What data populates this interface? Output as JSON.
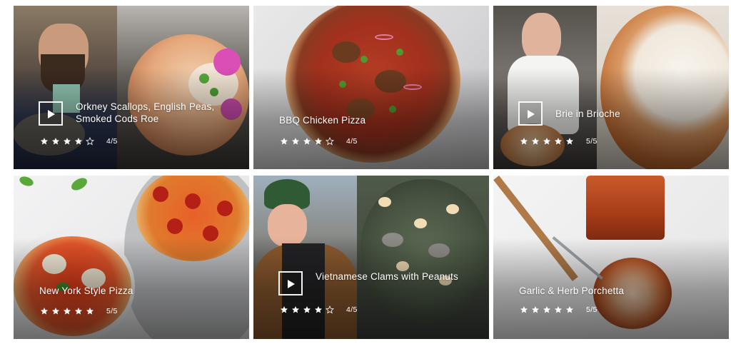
{
  "cards": [
    {
      "title": "Orkney Scallops, English Peas, Smoked Cods Roe",
      "rating": 4,
      "rating_label": "4/5",
      "has_video": true
    },
    {
      "title": "BBQ Chicken Pizza",
      "rating": 4,
      "rating_label": "4/5",
      "has_video": false
    },
    {
      "title": "Brie in Brioche",
      "rating": 5,
      "rating_label": "5/5",
      "has_video": true
    },
    {
      "title": "New York Style Pizza",
      "rating": 5,
      "rating_label": "5/5",
      "has_video": false
    },
    {
      "title": "Vietnamese Clams with Peanuts",
      "rating": 4,
      "rating_label": "4/5",
      "has_video": true
    },
    {
      "title": "Garlic & Herb Porchetta",
      "rating": 5,
      "rating_label": "5/5",
      "has_video": false
    }
  ],
  "icons": {
    "play": "play-icon",
    "star_full": "star-filled-icon",
    "star_empty": "star-outline-icon"
  },
  "colors": {
    "text": "#ffffff",
    "star": "#ffffff"
  }
}
